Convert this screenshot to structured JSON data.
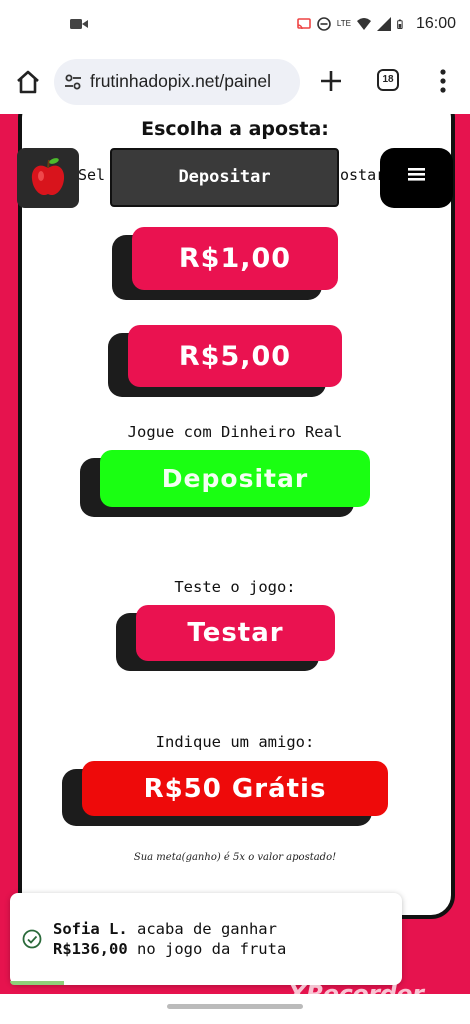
{
  "status_bar": {
    "time": "16:00",
    "lte_label": "LTE"
  },
  "browser": {
    "url": "frutinhadopix.net/painel",
    "tab_count": "18"
  },
  "page": {
    "choose_title": "Escolha a aposta:",
    "select_text_left": "Sel",
    "select_text_right": "ostar",
    "header_deposit_label": "Depositar",
    "bet_options": [
      "R$1,00",
      "R$5,00"
    ],
    "real_money_label": "Jogue com Dinheiro Real",
    "deposit_label": "Depositar",
    "test_label": "Teste o jogo:",
    "test_button": "Testar",
    "refer_label": "Indique um amigo:",
    "refer_button": "R$50 Grátis",
    "goal_note": "Sua meta(ganho) é 5x o valor apostado!"
  },
  "toast": {
    "user": "Sofia L.",
    "text1": " acaba de ganhar",
    "amount": "R$136,00",
    "text2": " no jogo da fruta"
  },
  "watermark": "XRecorder",
  "colors": {
    "brand_red": "#e6134e",
    "button_red": "#ea1250",
    "button_green": "#1aff12",
    "button_bright_red": "#ee0a0a"
  }
}
